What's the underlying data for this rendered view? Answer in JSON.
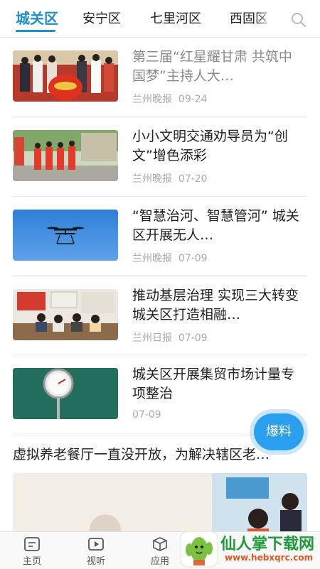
{
  "tabs": [
    {
      "label": "城关区",
      "active": true
    },
    {
      "label": "安宁区",
      "active": false
    },
    {
      "label": "七里河区",
      "active": false
    },
    {
      "label": "西固区",
      "active": false
    }
  ],
  "search_icon": "search-icon",
  "accent_color": "#1d8fd0",
  "news": [
    {
      "title": "第三届“红星耀甘肃 共筑中国梦”主持人大…",
      "source": "兰州晚报",
      "date": "09-24",
      "read": true
    },
    {
      "title": "小小文明交通劝导员为“创文”增色添彩",
      "source": "兰州晚报",
      "date": "07-20",
      "read": false
    },
    {
      "title": "“智慧治河、智慧管河” 城关区开展无人…",
      "source": "兰州晚报",
      "date": "07-09",
      "read": false
    },
    {
      "title": "推动基层治理 实现三大转变 城关区打造相融…",
      "source": "兰州日报",
      "date": "07-09",
      "read": false
    },
    {
      "title": "城关区开展集贸市场计量专项整治",
      "source": "",
      "date": "07-09",
      "read": false
    }
  ],
  "headline": "虚拟养老餐厅一直没开放，为解决辖区老…",
  "fab_label": "爆料",
  "bottom_nav": [
    {
      "label": "主页",
      "icon": "home-icon"
    },
    {
      "label": "视听",
      "icon": "video-icon"
    },
    {
      "label": "应用",
      "icon": "cube-icon"
    }
  ],
  "watermark": {
    "brand": "仙人掌下载网",
    "url": "www.hebxqrc.com"
  }
}
